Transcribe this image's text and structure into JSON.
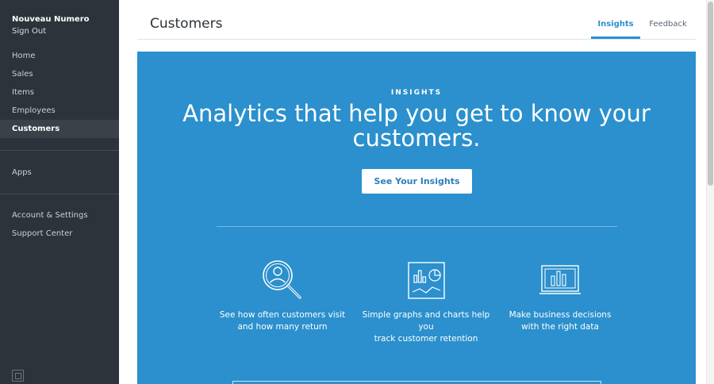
{
  "sidebar": {
    "brand": "Nouveau Numero",
    "sign_out": "Sign Out",
    "main_items": [
      "Home",
      "Sales",
      "Items",
      "Employees",
      "Customers"
    ],
    "active_item": "Customers",
    "apps": "Apps",
    "footer_items": [
      "Account & Settings",
      "Support Center"
    ]
  },
  "header": {
    "title": "Customers",
    "tabs": [
      "Insights",
      "Feedback"
    ],
    "active_tab": "Insights"
  },
  "hero": {
    "eyebrow": "INSIGHTS",
    "headline_line1": "Analytics that help you get to know your",
    "headline_line2": "customers.",
    "cta_label": "See Your Insights",
    "features": [
      {
        "icon": "magnifier-person-icon",
        "line1": "See how often customers visit",
        "line2": "and how many return"
      },
      {
        "icon": "chart-clipboard-icon",
        "line1": "Simple graphs and charts help you",
        "line2": "track customer retention"
      },
      {
        "icon": "laptop-chart-icon",
        "line1": "Make business decisions",
        "line2": "with the right data"
      }
    ]
  },
  "colors": {
    "sidebar_bg": "#2c333a",
    "accent": "#2b90d0",
    "hero_bg": "#2b90cd"
  }
}
